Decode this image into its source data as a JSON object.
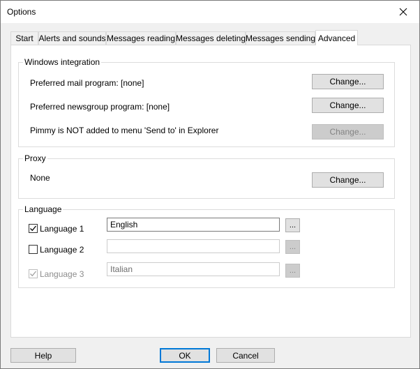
{
  "window": {
    "title": "Options"
  },
  "tabs": [
    {
      "label": "Start",
      "active": false
    },
    {
      "label": "Alerts and sounds",
      "active": false
    },
    {
      "label": "Messages reading",
      "active": false
    },
    {
      "label": "Messages deleting",
      "active": false
    },
    {
      "label": "Messages sending",
      "active": false
    },
    {
      "label": "Advanced",
      "active": true
    }
  ],
  "windows_integration": {
    "title": "Windows integration",
    "mail_label": "Preferred mail program: [none]",
    "mail_button": "Change...",
    "news_label": "Preferred newsgroup program: [none]",
    "news_button": "Change...",
    "sendto_label": "Pimmy is NOT added  to menu 'Send to' in Explorer",
    "sendto_button": "Change..."
  },
  "proxy": {
    "title": "Proxy",
    "value": "None",
    "button": "Change..."
  },
  "language": {
    "title": "Language",
    "items": [
      {
        "label": "Language 1",
        "checked": true,
        "enabled": true,
        "value": "English",
        "browse": "..."
      },
      {
        "label": "Language 2",
        "checked": false,
        "enabled": true,
        "value": "",
        "browse": "..."
      },
      {
        "label": "Language 3",
        "checked": true,
        "enabled": false,
        "value": "Italian",
        "browse": "..."
      }
    ]
  },
  "footer": {
    "help": "Help",
    "ok": "OK",
    "cancel": "Cancel"
  },
  "colors": {
    "window_bg": "#f0f0f0",
    "panel_bg": "#ffffff",
    "button_bg": "#e1e1e1",
    "focus_border": "#0078d7"
  }
}
